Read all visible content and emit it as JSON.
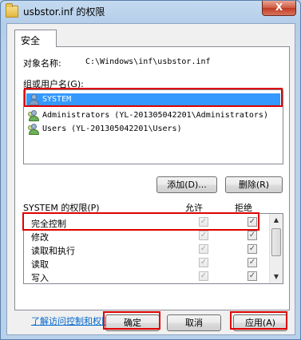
{
  "window": {
    "title": "usbstor.inf 的权限",
    "close_label": "X"
  },
  "tab": {
    "label": "安全"
  },
  "object": {
    "label": "对象名称:",
    "value": "C:\\Windows\\inf\\usbstor.inf"
  },
  "groups": {
    "label": "组或用户名(G):",
    "items": [
      {
        "name": "SYSTEM",
        "icon": "user-group-icon"
      },
      {
        "name": "Administrators (YL-201305042201\\Administrators)",
        "icon": "user-group-icon"
      },
      {
        "name": "Users (YL-201305042201\\Users)",
        "icon": "user-group-icon"
      }
    ],
    "add_button": "添加(D)...",
    "remove_button": "删除(R)"
  },
  "permissions": {
    "header": "SYSTEM 的权限(P)",
    "allow_header": "允许",
    "deny_header": "拒绝",
    "rows": [
      {
        "name": "完全控制",
        "allow": "✓",
        "deny": "✓"
      },
      {
        "name": "修改",
        "allow": "✓",
        "deny": "✓"
      },
      {
        "name": "读取和执行",
        "allow": "✓",
        "deny": "✓"
      },
      {
        "name": "读取",
        "allow": "✓",
        "deny": "✓"
      },
      {
        "name": "写入",
        "allow": "✓",
        "deny": "✓"
      }
    ]
  },
  "link": {
    "label": "了解访问控制和权限"
  },
  "footer": {
    "ok": "确定",
    "cancel": "取消",
    "apply": "应用(A)"
  },
  "colors": {
    "selection": "#3399ff",
    "highlight_box": "#e00000",
    "link": "#0066cc"
  }
}
